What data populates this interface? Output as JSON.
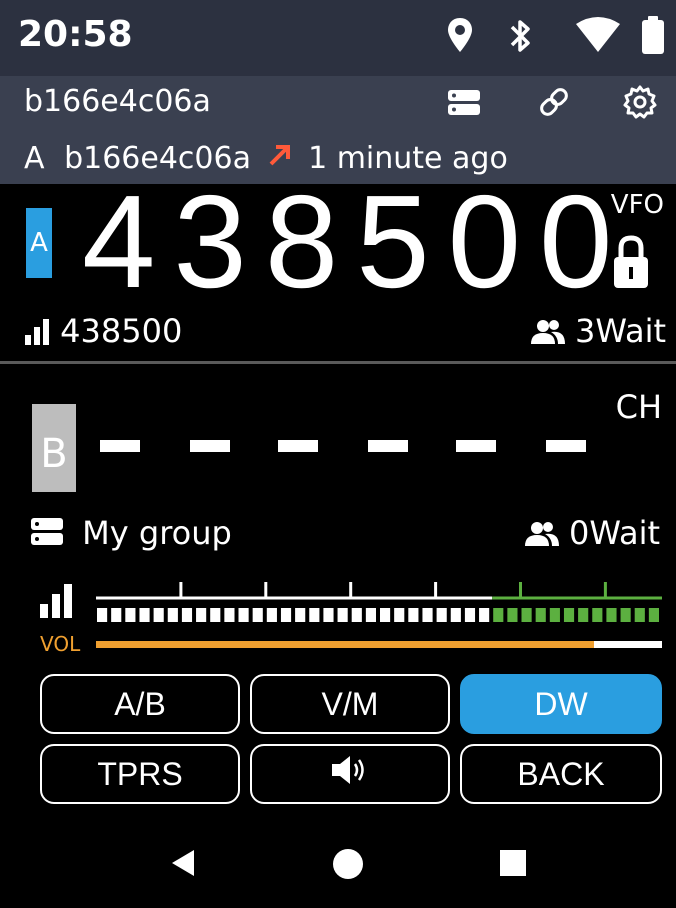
{
  "status_bar": {
    "time": "20:58",
    "icons": [
      "location-icon",
      "bluetooth-icon",
      "wifi-icon",
      "battery-icon"
    ]
  },
  "header": {
    "device_id": "b166e4c06a",
    "icons": [
      "server-icon",
      "link-icon",
      "settings-icon"
    ],
    "last_activity": {
      "band": "A",
      "device": "b166e4c06a",
      "direction_icon": "arrow-up-right-icon",
      "time_ago": "1 minute ago"
    }
  },
  "band_a": {
    "label": "A",
    "frequency": "438500",
    "mode": "VFO",
    "locked": true,
    "rx_frequency": "438500",
    "wait": "3Wait"
  },
  "band_b": {
    "label": "B",
    "channel_label": "CH",
    "frequency_placeholder": "— — — — — —",
    "group_name": "My group",
    "wait": "0Wait"
  },
  "meter": {
    "vol_label": "VOL",
    "volume_level": 0.88,
    "signal_segments": 40,
    "green_from_segment": 28
  },
  "buttons": {
    "ab": "A/B",
    "vm": "V/M",
    "dw": "DW",
    "tprs": "TPRS",
    "speaker_icon": "speaker-icon",
    "back": "BACK"
  },
  "colors": {
    "accent": "#2a9ee0",
    "volume": "#f0a030",
    "signal_green": "#5cb040",
    "arrow": "#ff5a3a"
  }
}
